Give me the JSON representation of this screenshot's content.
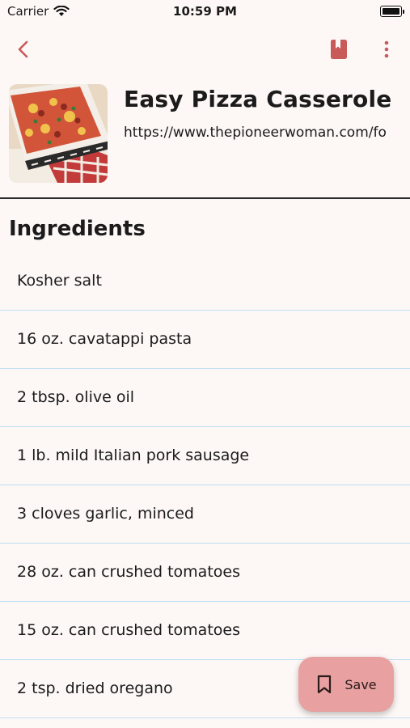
{
  "status_bar": {
    "carrier": "Carrier",
    "time": "10:59 PM"
  },
  "app_bar": {
    "back_icon": "chevron-left-icon",
    "bookmark_icon": "book-icon",
    "more_icon": "more-vertical-icon",
    "accent_color": "#c85a5a"
  },
  "recipe": {
    "title": "Easy Pizza Casserole",
    "url": "https://www.thepioneerwoman.com/fo"
  },
  "ingredients": {
    "heading": "Ingredients",
    "items": [
      "Kosher salt",
      "16 oz. cavatappi pasta",
      "2 tbsp. olive oil",
      "1 lb. mild Italian pork sausage",
      "3 cloves garlic, minced",
      "28 oz. can crushed tomatoes",
      "15 oz. can crushed tomatoes",
      "2 tsp. dried oregano"
    ]
  },
  "fab": {
    "label": "Save",
    "icon": "bookmark-icon",
    "color": "#e8a0a0"
  }
}
